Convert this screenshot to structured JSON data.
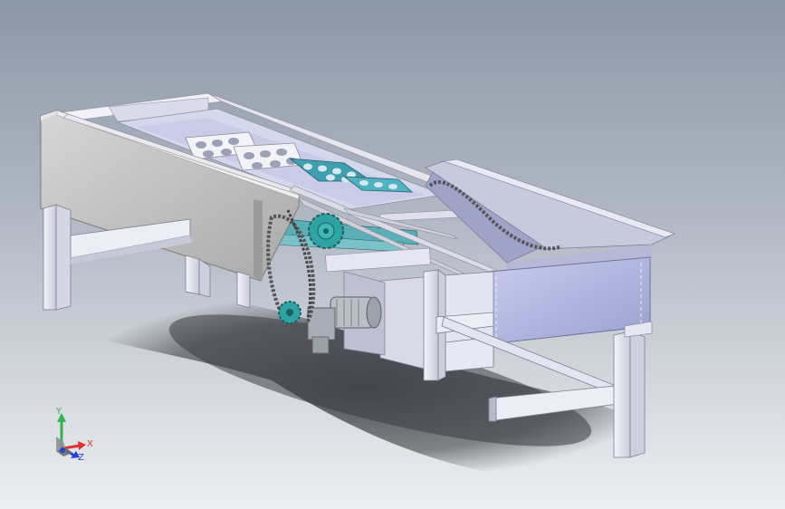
{
  "viewport": {
    "background_top": "#8c97a6",
    "background_bottom": "#eceef1"
  },
  "model": {
    "frame_color": "#ececf3",
    "hopper_color": "#b7bde4",
    "panel_color": "#c9c9c9",
    "chain_color": "#555555",
    "sprocket_color": "#2fa3a3",
    "motor_color": "#b9bfc6",
    "roller_color": "#5aaeb8",
    "shadow_color": "#3d3f44"
  },
  "axis_triad": {
    "x_label": "X",
    "y_label": "Y",
    "z_label": "Z",
    "x_color": "#e0322a",
    "y_color": "#37b24d",
    "z_color": "#2742d6"
  }
}
